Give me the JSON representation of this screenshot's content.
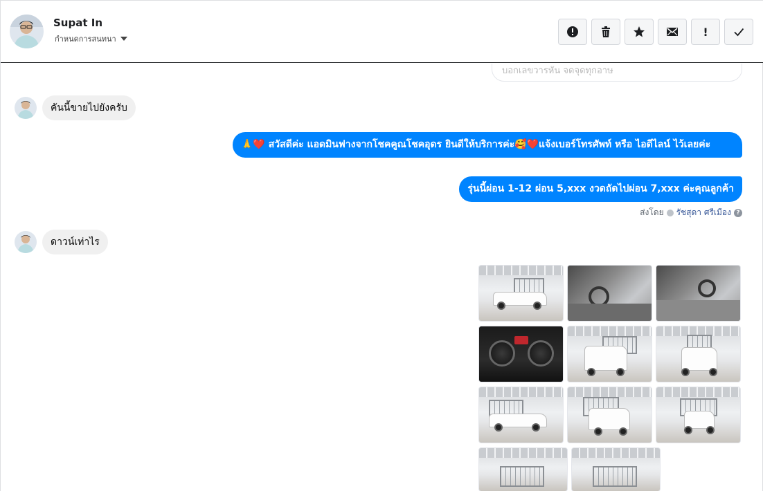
{
  "header": {
    "name": "Supat In",
    "subtitle": "กำหนดการสนทนา",
    "actions": [
      {
        "icon": "alert-circle-icon"
      },
      {
        "icon": "trash-icon"
      },
      {
        "icon": "star-icon"
      },
      {
        "icon": "envelope-icon"
      },
      {
        "icon": "exclamation-icon",
        "glyph": "!"
      },
      {
        "icon": "checkmark-icon"
      }
    ]
  },
  "messages": {
    "cutoff_text": "บอกเลขวารหัน จดจุดทุกอาษ",
    "incoming_1": "คันนี้ขายไปยังครับ",
    "outgoing_1": "🙏❤️ สวัสดีค่ะ แอดมินฟางจากโชคคูณโชคอุดร ยินดีให้บริการค่ะ🥰❤️แจ้งเบอร์โทรศัพท์ หรือ ไอดีไลน์  ไว้เลยค่ะ",
    "outgoing_2": "รุ่นนี้ผ่อน 1-12 ผ่อน 5,xxx งวดถัดไปผ่อน 7,xxx ค่ะคุณลูกค้า",
    "sent_by_label": "ส่งโดย",
    "sent_by_name": "รัชสุดา ศรีเมือง",
    "incoming_2": "ดาวน์เท่าไร"
  },
  "colors": {
    "accent": "#0084ff",
    "incoming_bubble": "#f0f0f0"
  }
}
